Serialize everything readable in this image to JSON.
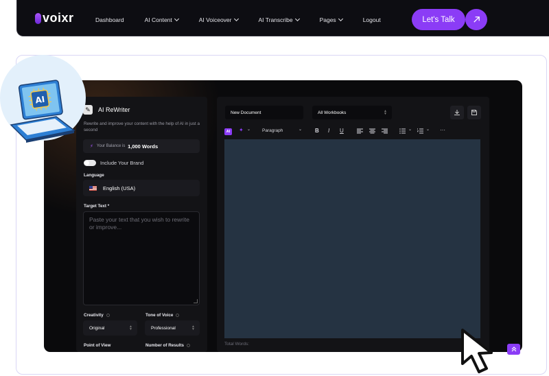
{
  "nav": {
    "logo": "voixr",
    "items": [
      {
        "label": "Dashboard",
        "dropdown": false
      },
      {
        "label": "AI Content",
        "dropdown": true
      },
      {
        "label": "AI Voiceover",
        "dropdown": true
      },
      {
        "label": "AI Transcribe",
        "dropdown": true
      },
      {
        "label": "Pages",
        "dropdown": true
      },
      {
        "label": "Logout",
        "dropdown": false
      }
    ],
    "cta_label": "Let's Talk",
    "accent": "#8b3cf6"
  },
  "left_panel": {
    "title": "AI ReWriter",
    "description": "Rewrite and improve your content with the help of AI in just a second",
    "balance_prefix": "Your Balance is",
    "balance_value": "1,000 Words",
    "brand_toggle_label": "Include Your Brand",
    "language_label": "Language",
    "language_value": "English (USA)",
    "target_label": "Target Text *",
    "target_placeholder": "Paste your text that you wish to rewrite or improve...",
    "creativity_label": "Creativity",
    "creativity_value": "Original",
    "tone_label": "Tone of Voice",
    "tone_value": "Professional",
    "pov_label": "Point of View",
    "results_label": "Number of Results"
  },
  "right_panel": {
    "doc_name": "New Document",
    "workbooks": "All Workbooks",
    "ai_badge": "AI",
    "paragraph_select": "Paragraph",
    "total_words_label": "Total Words:",
    "editor_bg": "#253342"
  },
  "icons": [
    "pen-icon",
    "bolt-icon",
    "download-icon",
    "save-icon",
    "bold-icon",
    "italic-icon",
    "underline-icon",
    "align-left-icon",
    "align-center-icon",
    "align-right-icon",
    "bullet-list-icon",
    "numbered-list-icon",
    "more-icon",
    "magic-wand-icon",
    "arrow-up-right-icon",
    "laptop-ai-icon",
    "cursor-icon",
    "scroll-top-icon"
  ]
}
